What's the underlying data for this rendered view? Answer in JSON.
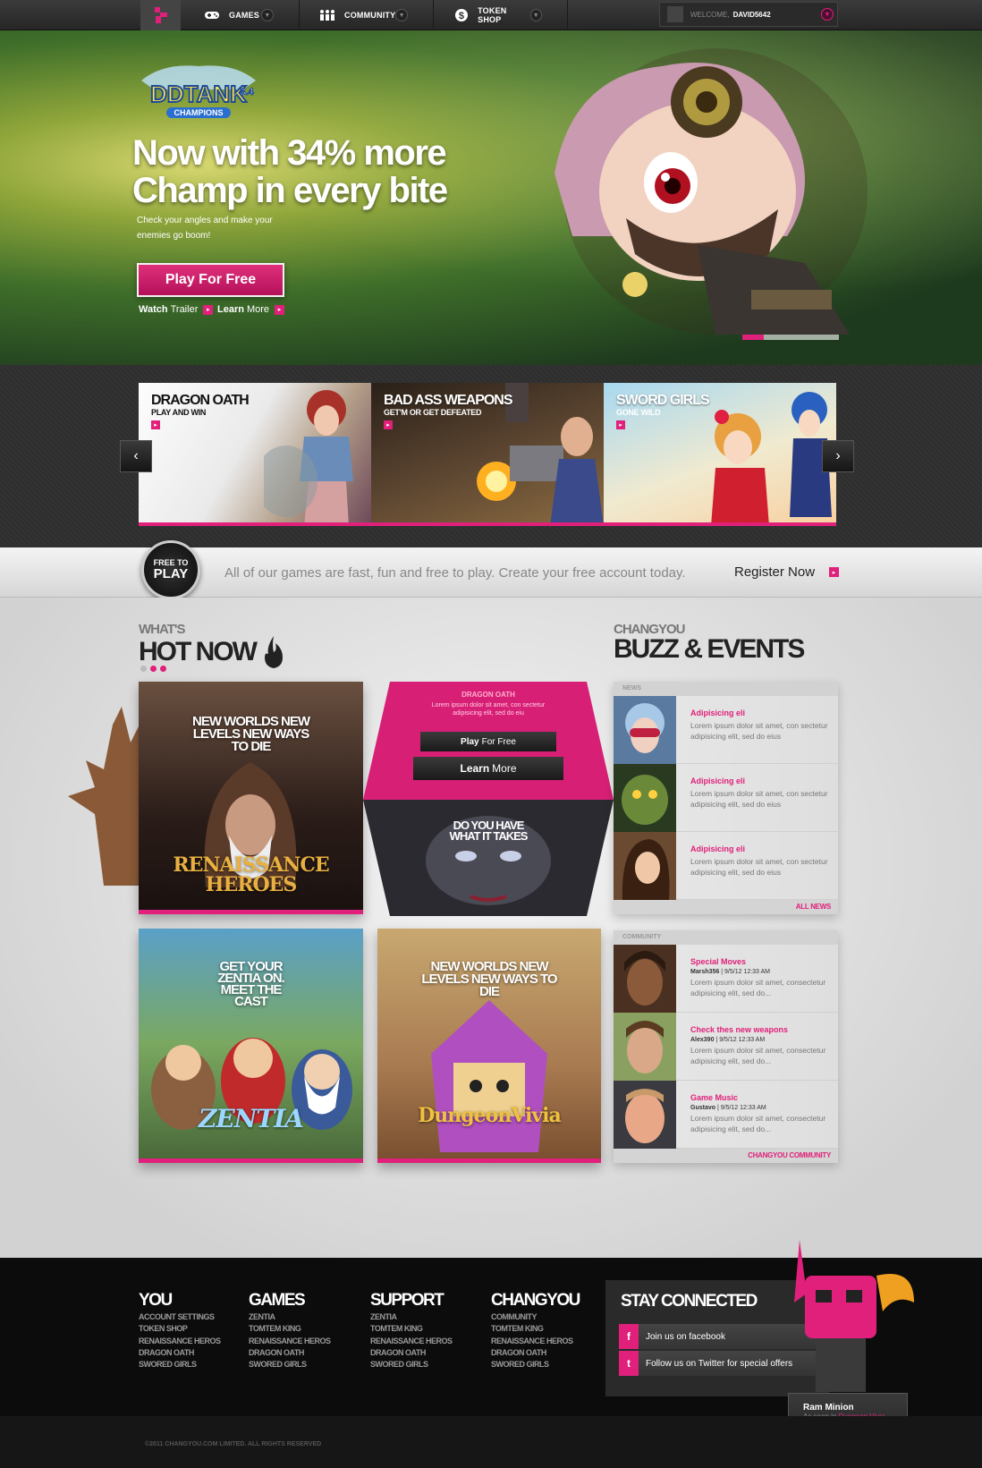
{
  "nav": {
    "games": "GAMES",
    "community": "COMMUNITY",
    "token_shop": "TOKEN SHOP",
    "welcome": "WELCOME,",
    "username": "DAVID5642"
  },
  "hero": {
    "logo_main": "DDTANK",
    "logo_ver": "3.4",
    "logo_sub": "CHAMPIONS",
    "headline1": "Now with 34% more",
    "headline2": "Champ in every bite",
    "subline": "Check your angles and make your enemies go boom!",
    "play": "Play For Free",
    "watch_b": "Watch",
    "watch": "Trailer",
    "learn_b": "Learn",
    "learn": "More",
    "slide_progress": 0.22
  },
  "carousel": {
    "cards": [
      {
        "title": "DRAGON OATH",
        "sub": "PLAY AND WIN"
      },
      {
        "title": "BAD ASS WEAPONS",
        "sub": "GET'M OR GET DEFEATED"
      },
      {
        "title": "SWORD GIRLS",
        "sub": "GONE WILD"
      }
    ]
  },
  "ftp": {
    "badge_top": "FREE TO",
    "badge_bottom": "PLAY",
    "text": "All of our games are fast, fun and free to play. Create your free account today.",
    "register": "Register Now"
  },
  "hot": {
    "small": "WHAT'S",
    "big": "HOT NOW",
    "tiles": [
      {
        "text": "NEW WORLDS NEW LEVELS NEW WAYS TO DIE",
        "logo": "RENAISSANCE HEROES"
      },
      {
        "title": "DRAGON OATH",
        "body": "Lorem ipsum dolor sit amet, con sectetur adipisicing elit, sed do eiu",
        "play_b": "Play",
        "play": "For Free",
        "learn_b": "Learn",
        "learn": "More",
        "bottom": "DO YOU HAVE WHAT IT TAKES"
      },
      {
        "text": "GET YOUR ZENTIA ON. MEET THE CAST",
        "logo": "ZENTIA"
      },
      {
        "text": "NEW WORLDS NEW LEVELS NEW WAYS TO DIE",
        "logo": "DungeonVivia"
      }
    ]
  },
  "buzz": {
    "small": "CHANGYOU",
    "big": "BUZZ & EVENTS",
    "news_label": "NEWS",
    "news": [
      {
        "title": "Adipisicing eli",
        "body": "Lorem ipsum dolor sit amet, con sectetur adipisicing elit, sed do eius"
      },
      {
        "title": "Adipisicing eli",
        "body": "Lorem ipsum dolor sit amet, con sectetur adipisicing elit, sed do eius"
      },
      {
        "title": "Adipisicing eli",
        "body": "Lorem ipsum dolor sit amet, con sectetur adipisicing elit, sed do eius"
      }
    ],
    "all_news": "ALL NEWS",
    "community_label": "COMMUNITY",
    "community": [
      {
        "title": "Special Moves",
        "author": "Marsh356",
        "date": "9/5/12 12:33 AM",
        "body": "Lorem ipsum dolor sit amet, consectetur adipisicing elit, sed do..."
      },
      {
        "title": "Check thes new weapons",
        "author": "Alex390",
        "date": "9/5/12 12:33 AM",
        "body": "Lorem ipsum dolor sit amet, consectetur adipisicing elit, sed do..."
      },
      {
        "title": "Game Music",
        "author": "Gustavo",
        "date": "9/5/12 12:33 AM",
        "body": "Lorem ipsum dolor sit amet, consectetur adipisicing elit, sed do..."
      }
    ],
    "community_link": "CHANGYOU COMMUNITY"
  },
  "footer": {
    "cols": [
      {
        "head": "YOU",
        "links": [
          "ACCOUNT SETTINGS",
          "TOKEN SHOP",
          "RENAISSANCE HEROS",
          "DRAGON OATH",
          "SWORED GIRLS"
        ]
      },
      {
        "head": "GAMES",
        "links": [
          "ZENTIA",
          "TOMTEM KING",
          "RENAISSANCE HEROS",
          "DRAGON OATH",
          "SWORED GIRLS"
        ]
      },
      {
        "head": "SUPPORT",
        "links": [
          "ZENTIA",
          "TOMTEM KING",
          "RENAISSANCE HEROS",
          "DRAGON OATH",
          "SWORED GIRLS"
        ]
      },
      {
        "head": "CHANGYOU",
        "links": [
          "COMMUNITY",
          "TOMTEM KING",
          "RENAISSANCE HEROS",
          "DRAGON OATH",
          "SWORED GIRLS"
        ]
      }
    ],
    "stay": "STAY CONNECTED",
    "facebook": "Join us on facebook",
    "twitter": "Follow us on Twitter for special offers",
    "minion_name": "Ram Minion",
    "minion_seen": "As seen in",
    "minion_game": "Dungeon Vivia",
    "copyright": "©2011 CHANGYOU.COM LIMITED. ALL RIGHTS RESERVED"
  },
  "colors": {
    "accent": "#e0207a",
    "dark": "#262626"
  }
}
